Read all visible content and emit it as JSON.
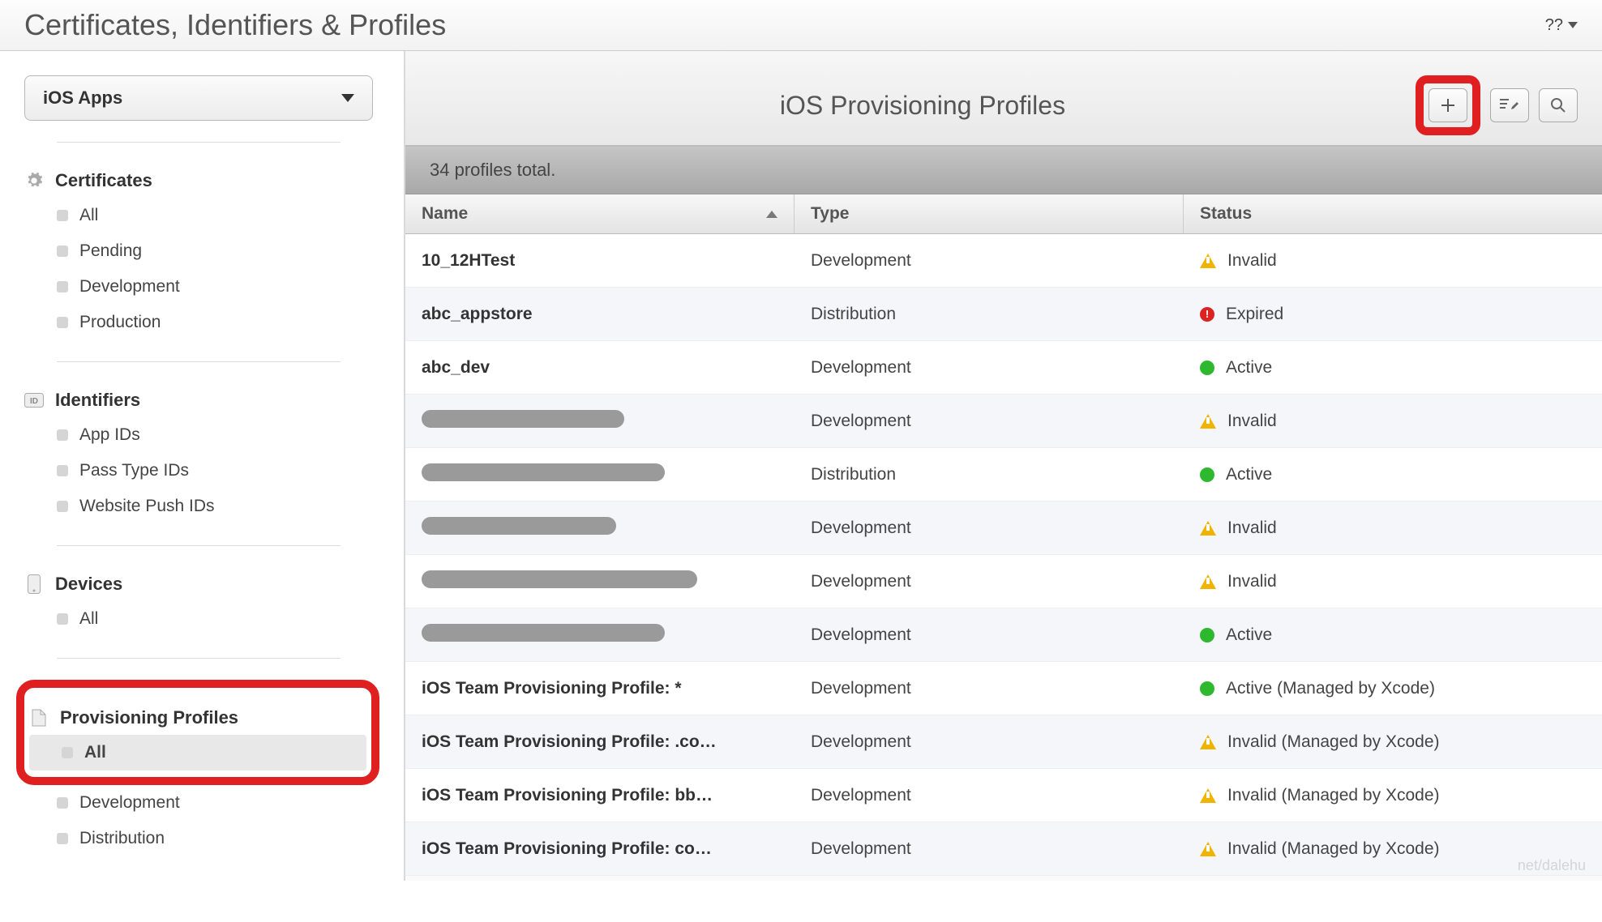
{
  "header": {
    "title": "Certificates, Identifiers & Profiles",
    "user_menu": "??"
  },
  "sidebar": {
    "selector_label": "iOS Apps",
    "sections": [
      {
        "heading": "Certificates",
        "icon": "gear",
        "items": [
          "All",
          "Pending",
          "Development",
          "Production"
        ]
      },
      {
        "heading": "Identifiers",
        "icon": "id",
        "items": [
          "App IDs",
          "Pass Type IDs",
          "Website Push IDs"
        ]
      },
      {
        "heading": "Devices",
        "icon": "device",
        "items": [
          "All"
        ]
      },
      {
        "heading": "Provisioning Profiles",
        "icon": "doc",
        "items": [
          "All",
          "Development",
          "Distribution"
        ],
        "selected": "All",
        "highlighted": true
      }
    ]
  },
  "main": {
    "title": "iOS Provisioning Profiles",
    "count_text": "34 profiles total.",
    "columns": {
      "name": "Name",
      "type": "Type",
      "status": "Status"
    },
    "rows": [
      {
        "name": "10_12HTest",
        "type": "Development",
        "status": "Invalid",
        "status_icon": "warn"
      },
      {
        "name": "abc_appstore",
        "type": "Distribution",
        "status": "Expired",
        "status_icon": "expired"
      },
      {
        "name": "abc_dev",
        "type": "Development",
        "status": "Active",
        "status_icon": "active"
      },
      {
        "name": "[redacted]",
        "redact_w": 250,
        "type": "Development",
        "status": "Invalid",
        "status_icon": "warn"
      },
      {
        "name": "[redacted]",
        "redact_w": 300,
        "type": "Distribution",
        "status": "Active",
        "status_icon": "active"
      },
      {
        "name": "[redacted]",
        "redact_w": 240,
        "type": "Development",
        "status": "Invalid",
        "status_icon": "warn"
      },
      {
        "name": "[redacted]",
        "redact_w": 340,
        "type": "Development",
        "status": "Invalid",
        "status_icon": "warn"
      },
      {
        "name": "[redacted]",
        "redact_w": 300,
        "type": "Development",
        "status": "Active",
        "status_icon": "active"
      },
      {
        "name": "iOS Team Provisioning Profile: *",
        "type": "Development",
        "status": "Active (Managed by Xcode)",
        "status_icon": "active"
      },
      {
        "name": "iOS Team Provisioning Profile: .co…",
        "type": "Development",
        "status": "Invalid (Managed by Xcode)",
        "status_icon": "warn"
      },
      {
        "name": "iOS Team Provisioning Profile: bb…",
        "type": "Development",
        "status": "Invalid (Managed by Xcode)",
        "status_icon": "warn"
      },
      {
        "name": "iOS Team Provisioning Profile: co…",
        "type": "Development",
        "status": "Invalid (Managed by Xcode)",
        "status_icon": "warn"
      }
    ]
  },
  "toolbar": {
    "add": "+",
    "edit": "≡✎",
    "search": "🔍"
  },
  "watermark": "net/dalehu"
}
